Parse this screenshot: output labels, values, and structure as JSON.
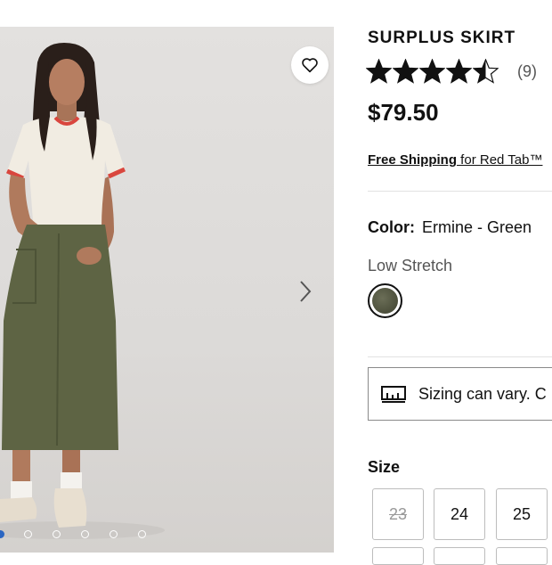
{
  "product": {
    "title": "SURPLUS SKIRT",
    "rating": 4.5,
    "review_count": "(9)",
    "price": "$79.50"
  },
  "shipping": {
    "link": "Free Shipping",
    "rest": " for Red Tab™"
  },
  "color": {
    "label": "Color:",
    "value": "Ermine - Green",
    "swatch_color": "#4c4f3b"
  },
  "stretch": "Low Stretch",
  "sizing_notice": "Sizing can vary. C",
  "size": {
    "label": "Size",
    "options": [
      {
        "label": "23",
        "available": false
      },
      {
        "label": "24",
        "available": true
      },
      {
        "label": "25",
        "available": true
      }
    ]
  },
  "gallery": {
    "image_count": 6,
    "active_index": 0,
    "icons": [
      "heart-icon",
      "chevron-right-icon"
    ]
  },
  "colors": {
    "accent": "#2b66c2",
    "text": "#111111",
    "muted": "#555555"
  }
}
